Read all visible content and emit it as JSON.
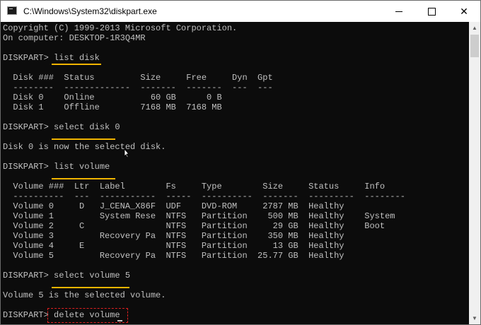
{
  "window": {
    "title": "C:\\Windows\\System32\\diskpart.exe",
    "controls": {
      "minimize": "minimize",
      "maximize": "maximize",
      "close": "close"
    }
  },
  "console": {
    "lines": [
      "Copyright (C) 1999-2013 Microsoft Corporation.",
      "On computer: DESKTOP-1R3Q4MR",
      "",
      "DISKPART> list disk",
      "",
      "  Disk ###  Status         Size     Free     Dyn  Gpt",
      "  --------  -------------  -------  -------  ---  ---",
      "  Disk 0    Online           60 GB      0 B",
      "  Disk 1    Offline        7168 MB  7168 MB",
      "",
      "DISKPART> select disk 0",
      "",
      "Disk 0 is now the selected disk.",
      "",
      "DISKPART> list volume",
      "",
      "  Volume ###  Ltr  Label        Fs     Type        Size     Status     Info",
      "  ----------  ---  -----------  -----  ----------  -------  ---------  --------",
      "  Volume 0     D   J_CENA_X86F  UDF    DVD-ROM     2787 MB  Healthy",
      "  Volume 1         System Rese  NTFS   Partition    500 MB  Healthy    System",
      "  Volume 2     C                NTFS   Partition     29 GB  Healthy    Boot",
      "  Volume 3         Recovery Pa  NTFS   Partition    350 MB  Healthy",
      "  Volume 4     E                NTFS   Partition     13 GB  Healthy",
      "  Volume 5         Recovery Pa  NTFS   Partition  25.77 GB  Healthy",
      "",
      "DISKPART> select volume 5",
      "",
      "Volume 5 is the selected volume.",
      "",
      "DISKPART> delete volume"
    ]
  },
  "colors": {
    "console_background": "#0c0c0c",
    "console_text": "#c0c0c0",
    "underline_highlight": "#f0b400",
    "dashed_box": "#e02020"
  }
}
